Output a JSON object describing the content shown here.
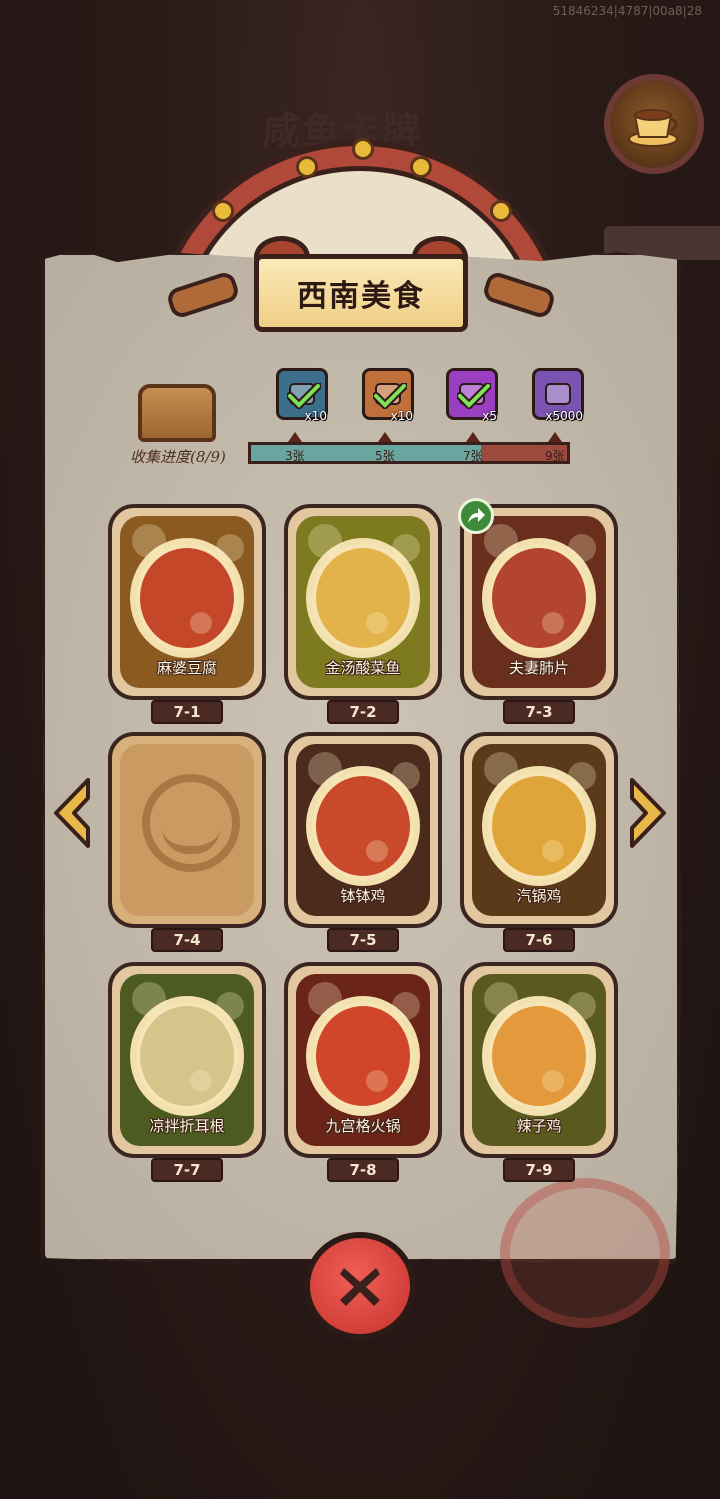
{
  "debug_text": "51846234|4787|00a8|28",
  "background_title": "咸鱼卡牌",
  "banner": {
    "title": "西南美食"
  },
  "collection": {
    "label": "收集进度(8/9)",
    "collected": 8,
    "total": 9,
    "milestones": [
      "3张",
      "5张",
      "7张",
      "9张"
    ]
  },
  "rewards": [
    {
      "icon": "treasure-chest-icon",
      "qty": "x10",
      "claimed": true,
      "color": "#3c6f8c"
    },
    {
      "icon": "key-icon",
      "qty": "x10",
      "claimed": true,
      "color": "#c0703a"
    },
    {
      "icon": "gem-orb-icon",
      "qty": "x5",
      "claimed": true,
      "color": "#9a3ec2"
    },
    {
      "icon": "crystal-icon",
      "qty": "x5000",
      "claimed": false,
      "color": "#7a54b0"
    }
  ],
  "cards": [
    {
      "id": "7-1",
      "name": "麻婆豆腐",
      "locked": false,
      "bg": "#8a5a20",
      "food": "#c4472a"
    },
    {
      "id": "7-2",
      "name": "金汤酸菜鱼",
      "locked": false,
      "bg": "#7d7a20",
      "food": "#e2b34a"
    },
    {
      "id": "7-3",
      "name": "夫妻肺片",
      "locked": false,
      "bg": "#6a2f1c",
      "food": "#b3452e"
    },
    {
      "id": "7-4",
      "name": "",
      "locked": true,
      "bg": "#c99a62",
      "food": "#c99a62"
    },
    {
      "id": "7-5",
      "name": "钵钵鸡",
      "locked": false,
      "bg": "#4c2a1c",
      "food": "#c84a2a"
    },
    {
      "id": "7-6",
      "name": "汽锅鸡",
      "locked": false,
      "bg": "#5a3a1a",
      "food": "#e0a53a"
    },
    {
      "id": "7-7",
      "name": "凉拌折耳根",
      "locked": false,
      "bg": "#4d5a20",
      "food": "#d7c48a"
    },
    {
      "id": "7-8",
      "name": "九宫格火锅",
      "locked": false,
      "bg": "#6a2418",
      "food": "#d1452a"
    },
    {
      "id": "7-9",
      "name": "辣子鸡",
      "locked": false,
      "bg": "#5a5a1e",
      "food": "#e39a3c"
    }
  ],
  "colors": {
    "parchment": "#c7bcac",
    "progress_fill": "#6aa6a0",
    "progress_empty": "#9c4a3e",
    "close_button": "#e14a42"
  }
}
